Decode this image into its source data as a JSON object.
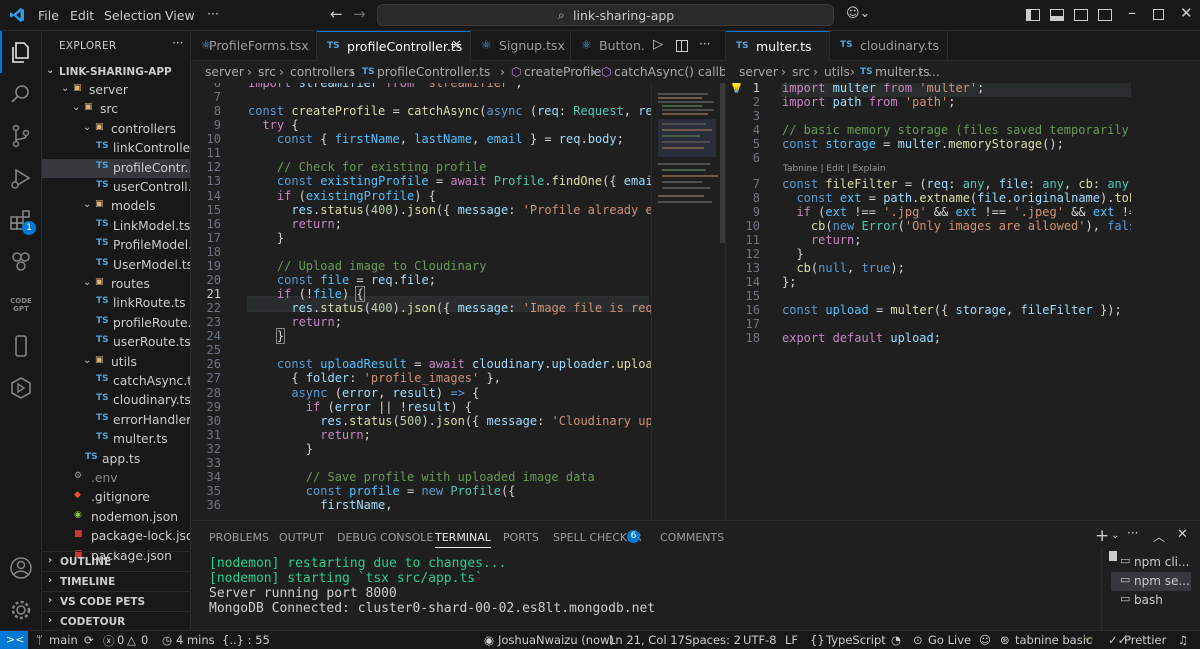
{
  "titlebar": {
    "menu": [
      "File",
      "Edit",
      "Selection",
      "View"
    ],
    "search": "link-sharing-app"
  },
  "sidebar": {
    "title": "EXPLORER",
    "root": "LINK-SHARING-APP",
    "items": [
      {
        "label": "server",
        "type": "folder",
        "depth": 1
      },
      {
        "label": "src",
        "type": "folder",
        "depth": 2
      },
      {
        "label": "controllers",
        "type": "folder",
        "depth": 3
      },
      {
        "label": "linkControlle...",
        "type": "ts",
        "depth": 4
      },
      {
        "label": "profileContr...",
        "type": "ts",
        "depth": 4
      },
      {
        "label": "userControll...",
        "type": "ts",
        "depth": 4
      },
      {
        "label": "models",
        "type": "folder",
        "depth": 3
      },
      {
        "label": "LinkModel.ts",
        "type": "ts",
        "depth": 4
      },
      {
        "label": "ProfileModel....",
        "type": "ts",
        "depth": 4
      },
      {
        "label": "UserModel.ts",
        "type": "ts",
        "depth": 4
      },
      {
        "label": "routes",
        "type": "folder",
        "depth": 3
      },
      {
        "label": "linkRoute.ts",
        "type": "ts",
        "depth": 4
      },
      {
        "label": "profileRoute....",
        "type": "ts",
        "depth": 4
      },
      {
        "label": "userRoute.ts",
        "type": "ts",
        "depth": 4
      },
      {
        "label": "utils",
        "type": "folder",
        "depth": 3
      },
      {
        "label": "catchAsync.ts",
        "type": "ts",
        "depth": 4
      },
      {
        "label": "cloudinary.ts",
        "type": "ts",
        "depth": 4
      },
      {
        "label": "errorHandler....",
        "type": "ts",
        "depth": 4
      },
      {
        "label": "multer.ts",
        "type": "ts",
        "depth": 4
      },
      {
        "label": "app.ts",
        "type": "ts",
        "depth": 3
      },
      {
        "label": ".env",
        "type": "env",
        "depth": 2
      },
      {
        "label": ".gitignore",
        "type": "git",
        "depth": 2
      },
      {
        "label": "nodemon.json",
        "type": "json",
        "depth": 2
      },
      {
        "label": "package-lock.json",
        "type": "npm",
        "depth": 2
      },
      {
        "label": "package.json",
        "type": "npm",
        "depth": 2
      }
    ],
    "sections": [
      "OUTLINE",
      "TIMELINE",
      "VS CODE PETS",
      "CODETOUR"
    ]
  },
  "activity": {
    "badge": "1",
    "codegpt": "CODE GPT"
  },
  "left_editor": {
    "tabs": [
      "ProfileForms.tsx",
      "profileController.ts",
      "Signup.tsx",
      "Button."
    ],
    "breadcrumb": [
      "server",
      "src",
      "controllers",
      "profileController.ts",
      "createProfile",
      "catchAsync() callback"
    ],
    "current_line": "21"
  },
  "right_editor": {
    "tabs": [
      "multer.ts",
      "cloudinary.ts"
    ],
    "breadcrumb": [
      "server",
      "src",
      "utils",
      "multer.ts",
      "..."
    ],
    "codelens": "Tabnine | Edit | Explain"
  },
  "panel": {
    "tabs": [
      "PROBLEMS",
      "OUTPUT",
      "DEBUG CONSOLE",
      "TERMINAL",
      "PORTS",
      "SPELL CHECKER",
      "COMMENTS"
    ],
    "spell_badge": "6",
    "terminal_lines": [
      "[nodemon] restarting due to changes...",
      "[nodemon] starting `tsx src/app.ts`",
      "Server running port 8000",
      "MongoDB Connected: cluster0-shard-00-02.es8lt.mongodb.net"
    ],
    "terminals": [
      "npm  cli...",
      "npm  se...",
      "bash"
    ]
  },
  "statusbar": {
    "remote": "><",
    "branch": "main",
    "errors": "0",
    "warnings": "0",
    "timer": "4 mins",
    "braces": "{..} : 55",
    "author": "JoshuaNwaizu (now)",
    "position": "Ln 21, Col 17",
    "spaces": "Spaces: 2",
    "encoding": "UTF-8",
    "eol": "LF",
    "language": "TypeScript",
    "golive": "Go Live",
    "tabnine": "tabnine basic",
    "prettier": "Prettier"
  },
  "colors": {
    "accent": "#0078d4",
    "editor_bg": "#1f1f1f",
    "chrome_bg": "#181818",
    "terminal_green": "#23d18b"
  }
}
